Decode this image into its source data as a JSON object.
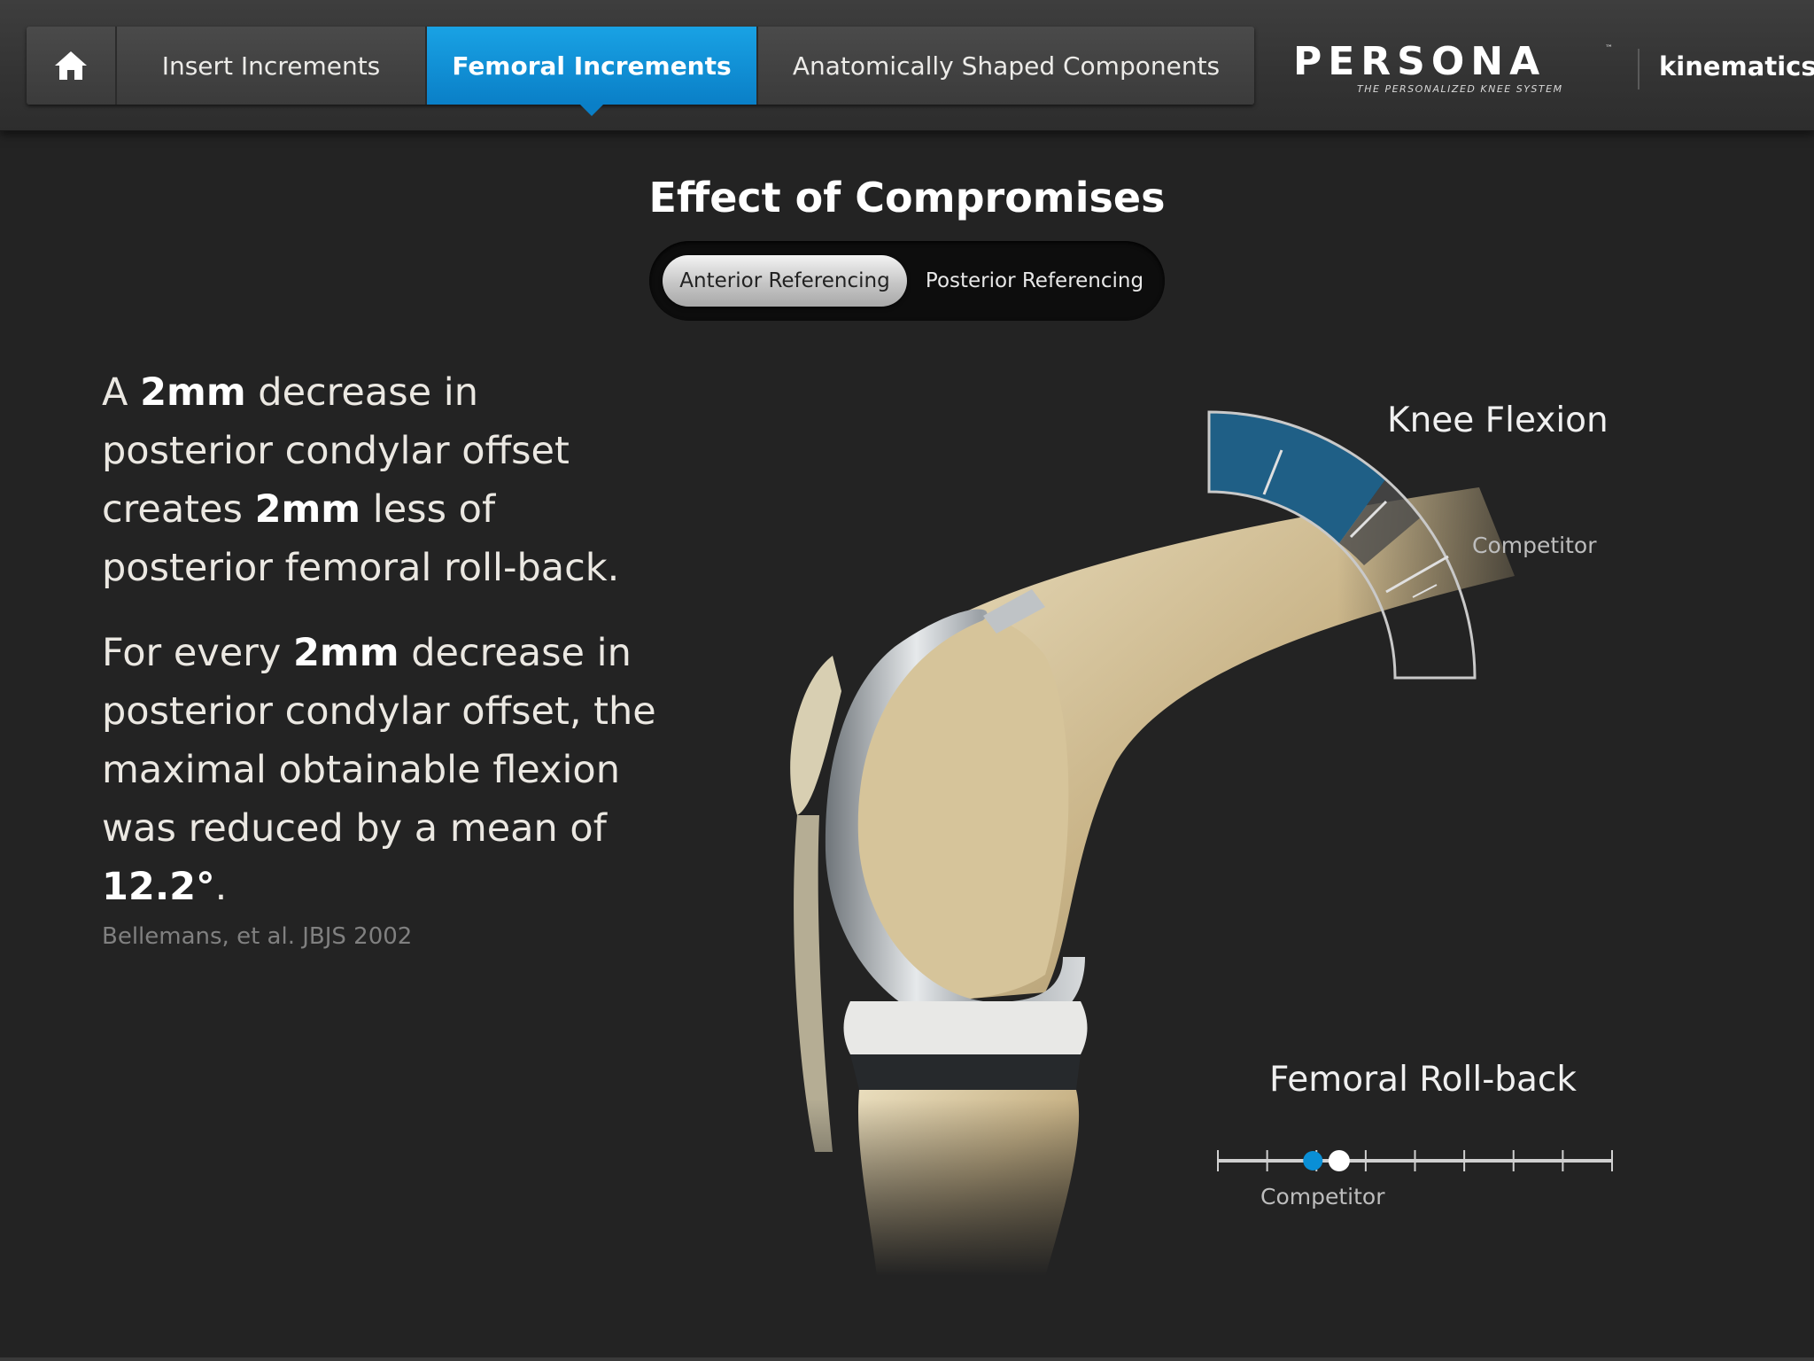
{
  "nav": {
    "home_icon": "home-icon",
    "tabs": [
      {
        "label": "Insert Increments",
        "active": false
      },
      {
        "label": "Femoral Increments",
        "active": true
      },
      {
        "label": "Anatomically Shaped Components",
        "active": false
      }
    ]
  },
  "brand": {
    "name": "PERSONA",
    "tm": "™",
    "tagline": "THE PERSONALIZED KNEE SYSTEM",
    "product": "kinematics"
  },
  "page": {
    "title": "Effect of Compromises",
    "segment": {
      "options": [
        "Anterior Referencing",
        "Posterior Referencing"
      ],
      "selected": "Anterior Referencing"
    }
  },
  "text": {
    "p1": [
      {
        "t": "A ",
        "b": false
      },
      {
        "t": "2mm",
        "b": true
      },
      {
        "t": " decrease in posterior condylar offset creates ",
        "b": false
      },
      {
        "t": "2mm",
        "b": true
      },
      {
        "t": " less of posterior femoral roll-back.",
        "b": false
      }
    ],
    "p2": [
      {
        "t": "For every ",
        "b": false
      },
      {
        "t": "2mm",
        "b": true
      },
      {
        "t": " decrease in posterior condylar offset, the maximal obtainable flexion was reduced by a mean of ",
        "b": false
      },
      {
        "t": "12.2°",
        "b": true
      },
      {
        "t": ".",
        "b": false
      }
    ],
    "citation": "Bellemans, et al. JBJS 2002"
  },
  "knee_flexion": {
    "title": "Knee Flexion",
    "competitor_label": "Competitor"
  },
  "femoral_rollback": {
    "title": "Femoral Roll-back",
    "competitor_label": "Competitor",
    "ticks": 9,
    "competitor_index": 2,
    "persona_index": 3
  },
  "colors": {
    "accent": "#0a8fd6",
    "gauge_fill": "#1f5f86",
    "background": "#232323"
  }
}
